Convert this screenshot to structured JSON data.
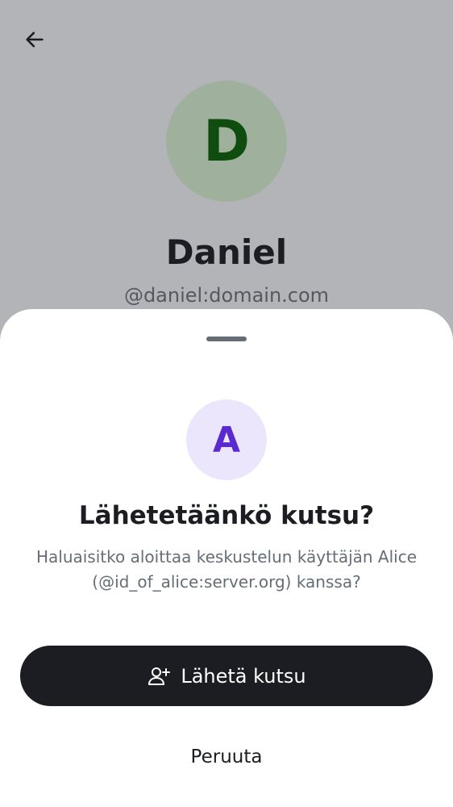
{
  "profile": {
    "avatar_initial": "D",
    "name": "Daniel",
    "handle": "@daniel:domain.com"
  },
  "icons": {
    "back": "arrow-left-icon",
    "invite": "user-add-icon"
  },
  "sheet": {
    "avatar_initial": "A",
    "title": "Lähetetäänkö kutsu?",
    "message": "Haluaisitko aloittaa keskustelun käyttäjän Alice (@id_of_alice:server.org) kanssa?",
    "send_label": "Lähetä kutsu",
    "cancel_label": "Peruuta"
  },
  "colors": {
    "scrim_background": "#b3b4b7",
    "profile_avatar_bg": "#9fb09d",
    "profile_avatar_text": "#0e4d0e",
    "invitee_avatar_bg": "#ebe6fb",
    "invitee_avatar_text": "#5a2ad0",
    "primary_button_bg": "#1b1d22",
    "primary_button_text": "#ffffff"
  }
}
